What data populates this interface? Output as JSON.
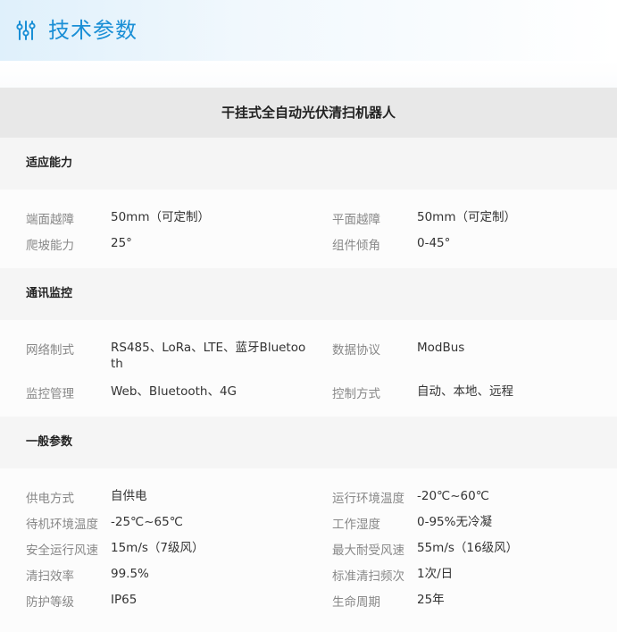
{
  "header": {
    "title": "技术参数",
    "icon": "sliders-icon",
    "accent": "#1a8fd6"
  },
  "product": {
    "name": "干挂式全自动光伏清扫机器人"
  },
  "sections": [
    {
      "title": "适应能力",
      "rows": [
        [
          {
            "label": "端面越障",
            "value": "50mm（可定制）"
          },
          {
            "label": "平面越障",
            "value": "50mm（可定制）"
          }
        ],
        [
          {
            "label": "爬坡能力",
            "value": "25°"
          },
          {
            "label": "组件倾角",
            "value": "0-45°"
          }
        ]
      ]
    },
    {
      "title": "通讯监控",
      "rows": [
        [
          {
            "label": "网络制式",
            "value": "RS485、LoRa、LTE、蓝牙Bluetooth"
          },
          {
            "label": "数据协议",
            "value": "ModBus"
          }
        ],
        [
          {
            "label": "监控管理",
            "value": "Web、Bluetooth、4G"
          },
          {
            "label": "控制方式",
            "value": "自动、本地、远程"
          }
        ]
      ]
    },
    {
      "title": "一般参数",
      "rows": [
        [
          {
            "label": "供电方式",
            "value": "自供电"
          },
          {
            "label": "运行环境温度",
            "value": "-20℃~60℃"
          }
        ],
        [
          {
            "label": "待机环境温度",
            "value": "-25℃~65℃"
          },
          {
            "label": "工作湿度",
            "value": "0-95%无冷凝"
          }
        ],
        [
          {
            "label": "安全运行风速",
            "value": "15m/s（7级风）"
          },
          {
            "label": "最大耐受风速",
            "value": "55m/s（16级风）"
          }
        ],
        [
          {
            "label": "清扫效率",
            "value": "99.5%"
          },
          {
            "label": "标准清扫频次",
            "value": "1次/日"
          }
        ],
        [
          {
            "label": "防护等级",
            "value": "IP65"
          },
          {
            "label": "生命周期",
            "value": "25年"
          }
        ]
      ]
    }
  ]
}
